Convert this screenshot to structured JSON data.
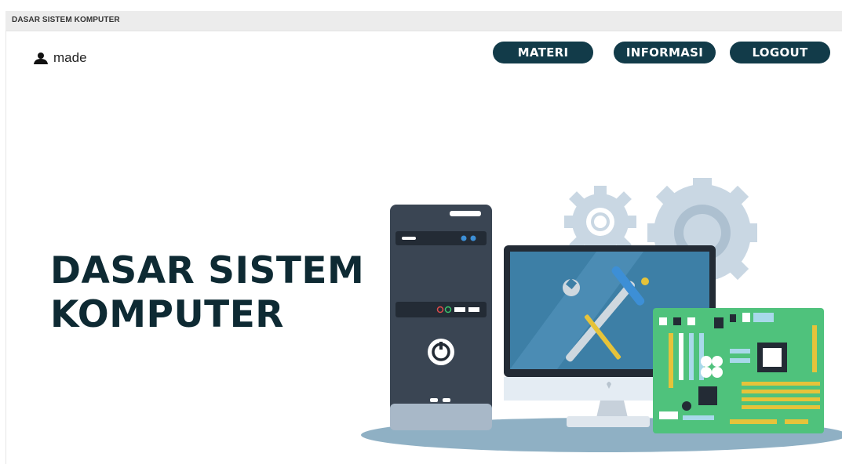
{
  "window": {
    "title": "DASAR SISTEM KOMPUTER"
  },
  "user": {
    "name": "made",
    "icon": "user-icon"
  },
  "nav": {
    "materi": "MATERI",
    "informasi": "INFORMASI",
    "logout": "LOGOUT"
  },
  "hero": {
    "line1": "DASAR SISTEM",
    "line2": "KOMPUTER"
  },
  "colors": {
    "button_bg": "#123b49",
    "title_text": "#0e2a33",
    "titlebar_bg": "#ececec"
  }
}
